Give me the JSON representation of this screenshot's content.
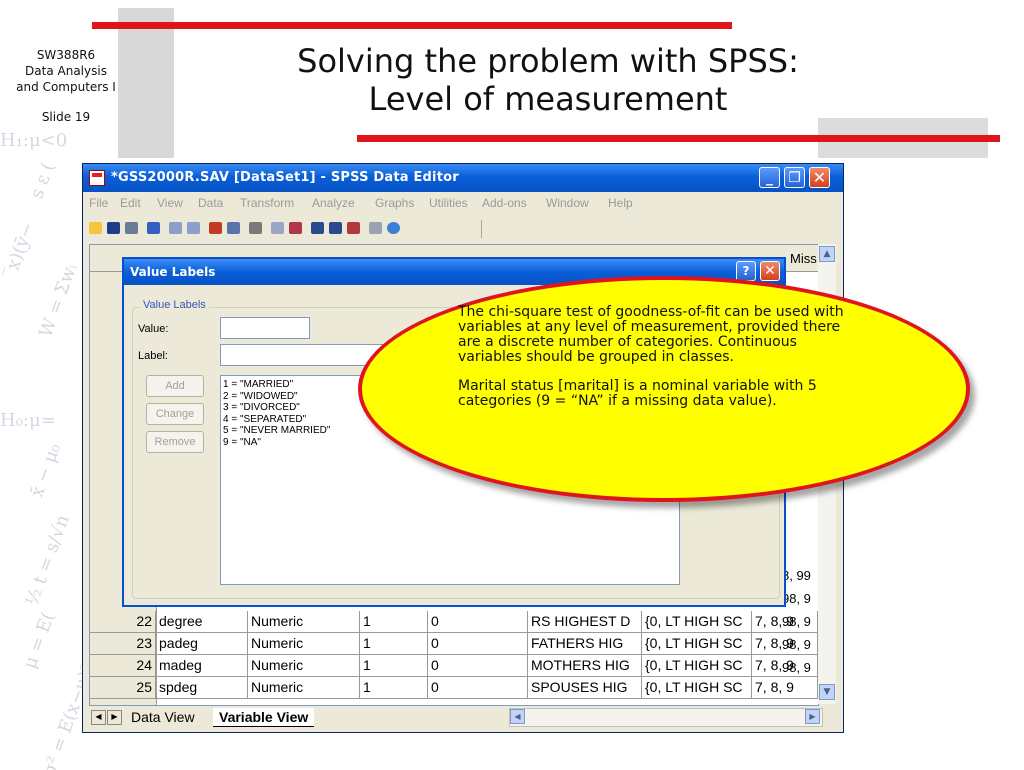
{
  "slide": {
    "course_code": "SW388R6",
    "course_name_1": "Data Analysis",
    "course_name_2": "and Computers I",
    "slide_number": "Slide 19",
    "title_line1": "Solving the problem with SPSS:",
    "title_line2": "Level of measurement",
    "accent_color": "#e0151b"
  },
  "window": {
    "title": "*GSS2000R.SAV [DataSet1] - SPSS Data Editor",
    "minimize_label": "_",
    "maximize_label": "❐",
    "close_label": "✕",
    "menu": [
      "File",
      "Edit",
      "View",
      "Data",
      "Transform",
      "Analyze",
      "Graphs",
      "Utilities",
      "Add-ons",
      "Window",
      "Help"
    ]
  },
  "grid": {
    "header_missing": "Miss",
    "partial_values": [
      "8, 99",
      "98, 9",
      "98, 9",
      "98, 9",
      "98, 9"
    ],
    "rows": [
      {
        "num": "22",
        "name": "degree",
        "type": "Numeric",
        "width": "1",
        "decimals": "0",
        "label": "RS HIGHEST D",
        "values": "{0, LT HIGH SC",
        "missing": "7, 8, 9"
      },
      {
        "num": "23",
        "name": "padeg",
        "type": "Numeric",
        "width": "1",
        "decimals": "0",
        "label": "FATHERS HIG",
        "values": "{0, LT HIGH SC",
        "missing": "7, 8, 9"
      },
      {
        "num": "24",
        "name": "madeg",
        "type": "Numeric",
        "width": "1",
        "decimals": "0",
        "label": "MOTHERS HIG",
        "values": "{0, LT HIGH SC",
        "missing": "7, 8, 9"
      },
      {
        "num": "25",
        "name": "spdeg",
        "type": "Numeric",
        "width": "1",
        "decimals": "0",
        "label": "SPOUSES HIG",
        "values": "{0, LT HIGH SC",
        "missing": "7, 8, 9"
      }
    ]
  },
  "tabs": {
    "data_view": "Data View",
    "variable_view": "Variable View"
  },
  "dialog": {
    "title": "Value Labels",
    "help_label": "?",
    "close_label": "✕",
    "group_label": "Value Labels",
    "value_label": "Value:",
    "value_input": "",
    "label_label": "Label:",
    "label_input": "",
    "add_button": "Add",
    "change_button": "Change",
    "remove_button": "Remove",
    "list_items": [
      "1 = \"MARRIED\"",
      "2 = \"WIDOWED\"",
      "3 = \"DIVORCED\"",
      "4 = \"SEPARATED\"",
      "5 = \"NEVER MARRIED\"",
      "9 = \"NA\""
    ]
  },
  "callout": {
    "fill_color": "#ffff00",
    "border_color": "#e0151b",
    "paragraph1": "The chi-square test of goodness-of-fit can be used with variables at any level of measurement, provided there are a discrete number of categories.  Continuous variables should be grouped in classes.",
    "paragraph2": "Marital status [marital] is a nominal variable with 5 categories (9 = “NA” if a missing data value)."
  }
}
